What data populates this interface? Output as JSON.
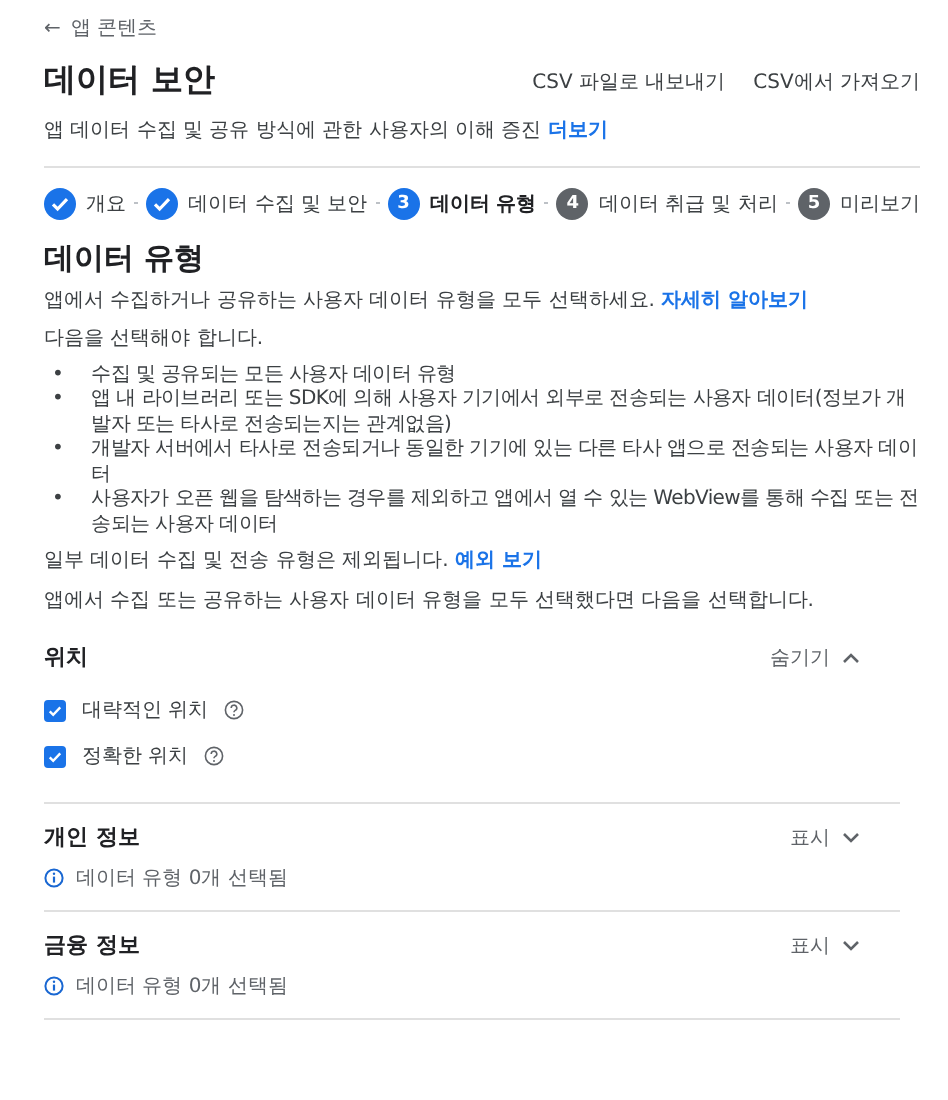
{
  "back_link": {
    "icon": "←",
    "label": "앱 콘텐츠"
  },
  "title": "데이터 보안",
  "actions": [
    "CSV 파일로 내보내기",
    "CSV에서 가져오기"
  ],
  "subtitle": {
    "text": "앱 데이터 수집 및 공유 방식에 관한 사용자의 이해 증진",
    "link": "더보기"
  },
  "steps": [
    {
      "label": "개요",
      "completed": true,
      "selected": false
    },
    {
      "label": "데이터 수집 및 보안",
      "completed": true,
      "selected": false
    },
    {
      "number": "3",
      "label": "데이터 유형",
      "completed": false,
      "selected": true
    },
    {
      "number": "4",
      "label": "데이터 취급 및 처리",
      "completed": false,
      "selected": false
    },
    {
      "number": "5",
      "label": "미리보기",
      "completed": false,
      "selected": false
    }
  ],
  "heading": "데이터 유형",
  "intro": {
    "text": "앱에서 수집하거나 공유하는 사용자 데이터 유형을 모두 선택하세요.",
    "link": "자세히 알아보기"
  },
  "must_select": "다음을 선택해야 합니다.",
  "bullets": [
    {
      "marker": "•",
      "text": "수집 및 공유되는 모든 사용자 데이터 유형"
    },
    {
      "marker": "•",
      "text": "앱 내 라이브러리 또는 SDK에 의해 사용자 기기에서 외부로 전송되는 사용자 데이터(정보가 개발자 또는 타사로 전송되는지는 관계없음)"
    },
    {
      "marker": "•",
      "text": "개발자 서버에서 타사로 전송되거나 동일한 기기에 있는 다른 타사 앱으로 전송되는 사용자 데이터"
    },
    {
      "marker": "•",
      "text": "사용자가 오픈 웹을 탐색하는 경우를 제외하고 앱에서 열 수 있는 WebView를 통해 수집 또는 전송되는 사용자 데이터"
    }
  ],
  "exclusions": {
    "text": "일부 데이터 수집 및 전송 유형은 제외됩니다.",
    "link": "예외 보기"
  },
  "instruction": "앱에서 수집 또는 공유하는 사용자 데이터 유형을 모두 선택했다면 다음을 선택합니다.",
  "sections": [
    {
      "title": "위치",
      "toggle": "숨기기",
      "expanded": true,
      "items": [
        {
          "label": "대략적인 위치",
          "checked": true
        },
        {
          "label": "정확한 위치",
          "checked": true
        }
      ]
    },
    {
      "title": "개인 정보",
      "toggle": "표시",
      "expanded": false,
      "summary": "데이터 유형 0개 선택됨"
    },
    {
      "title": "금융 정보",
      "toggle": "표시",
      "expanded": false,
      "summary": "데이터 유형 0개 선택됨"
    }
  ]
}
